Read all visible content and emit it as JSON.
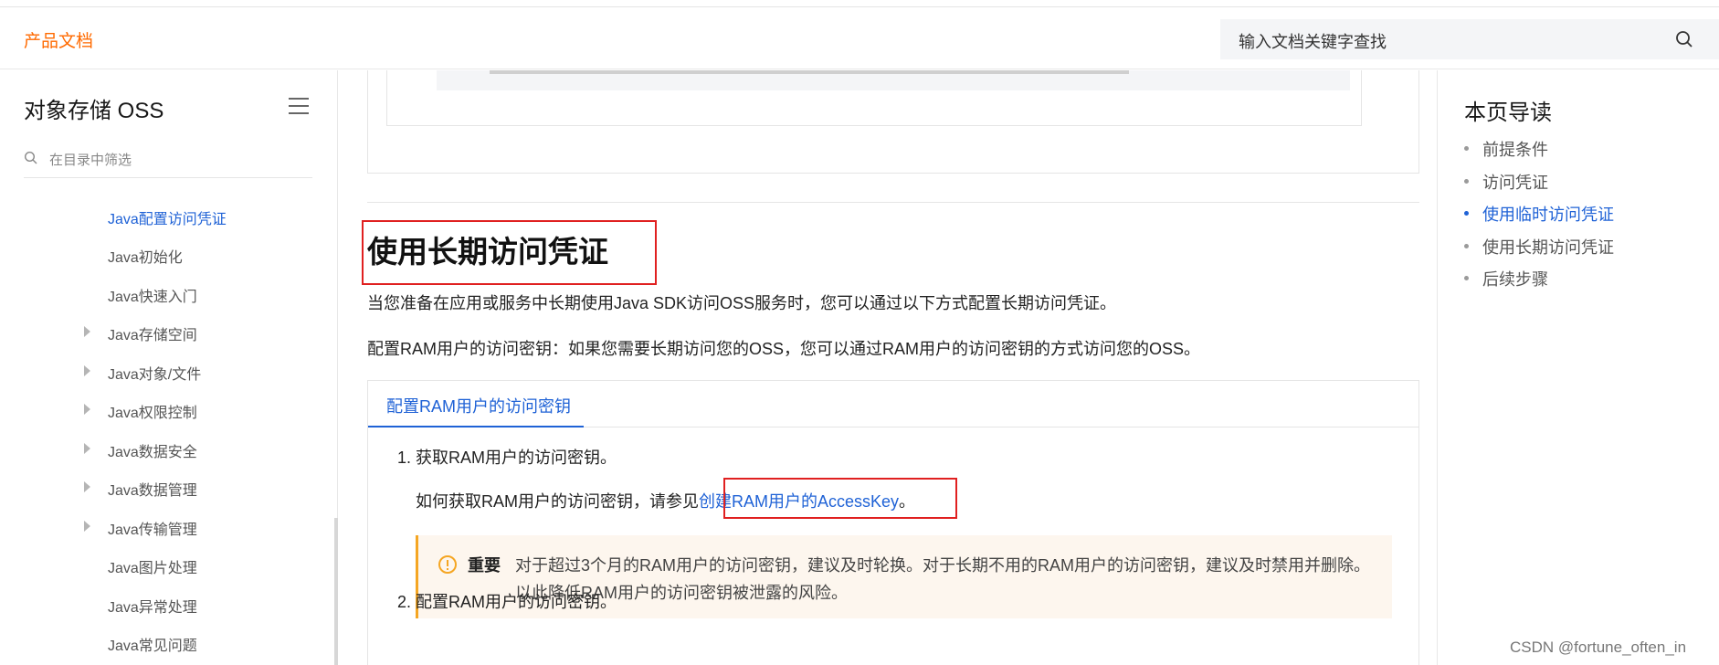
{
  "header": {
    "brand": "产品文档",
    "search_placeholder": "输入文档关键字查找"
  },
  "sidebar": {
    "title": "对象存储 OSS",
    "filter_placeholder": "在目录中筛选",
    "items": [
      {
        "label": "Java配置访问凭证",
        "active": true,
        "expandable": false
      },
      {
        "label": "Java初始化",
        "active": false,
        "expandable": false
      },
      {
        "label": "Java快速入门",
        "active": false,
        "expandable": false
      },
      {
        "label": "Java存储空间",
        "active": false,
        "expandable": true
      },
      {
        "label": "Java对象/文件",
        "active": false,
        "expandable": true
      },
      {
        "label": "Java权限控制",
        "active": false,
        "expandable": true
      },
      {
        "label": "Java数据安全",
        "active": false,
        "expandable": true
      },
      {
        "label": "Java数据管理",
        "active": false,
        "expandable": true
      },
      {
        "label": "Java传输管理",
        "active": false,
        "expandable": true
      },
      {
        "label": "Java图片处理",
        "active": false,
        "expandable": false
      },
      {
        "label": "Java异常处理",
        "active": false,
        "expandable": false
      },
      {
        "label": "Java常见问题",
        "active": false,
        "expandable": false
      }
    ]
  },
  "main": {
    "heading": "使用长期访问凭证",
    "para1": "当您准备在应用或服务中长期使用Java SDK访问OSS服务时，您可以通过以下方式配置长期访问凭证。",
    "para2": "配置RAM用户的访问密钥：如果您需要长期访问您的OSS，您可以通过RAM用户的访问密钥的方式访问您的OSS。",
    "tab_label": "配置RAM用户的访问密钥",
    "step1": "1. 获取RAM用户的访问密钥。",
    "step1_sub_prefix": "如何获取RAM用户的访问密钥，请参见",
    "step1_link": "创建RAM用户的AccessKey",
    "step1_sub_suffix": "。",
    "notice_tag": "重要",
    "notice_line1": "对于超过3个月的RAM用户的访问密钥，建议及时轮换。对于长期不用的RAM用户的访问密钥，建议及时禁用并删除。",
    "notice_line2": "以此降低RAM用户的访问密钥被泄露的风险。",
    "step2": "2. 配置RAM用户的访问密钥。"
  },
  "toc": {
    "title": "本页导读",
    "items": [
      {
        "label": "前提条件",
        "active": false
      },
      {
        "label": "访问凭证",
        "active": false
      },
      {
        "label": "使用临时访问凭证",
        "active": true
      },
      {
        "label": "使用长期访问凭证",
        "active": false
      },
      {
        "label": "后续步骤",
        "active": false
      }
    ]
  },
  "watermark": "CSDN @fortune_often_in",
  "colors": {
    "brand": "#ff6a00",
    "link": "#1f62d6",
    "highlight_box": "#e02020",
    "notice_accent": "#f5a623"
  }
}
